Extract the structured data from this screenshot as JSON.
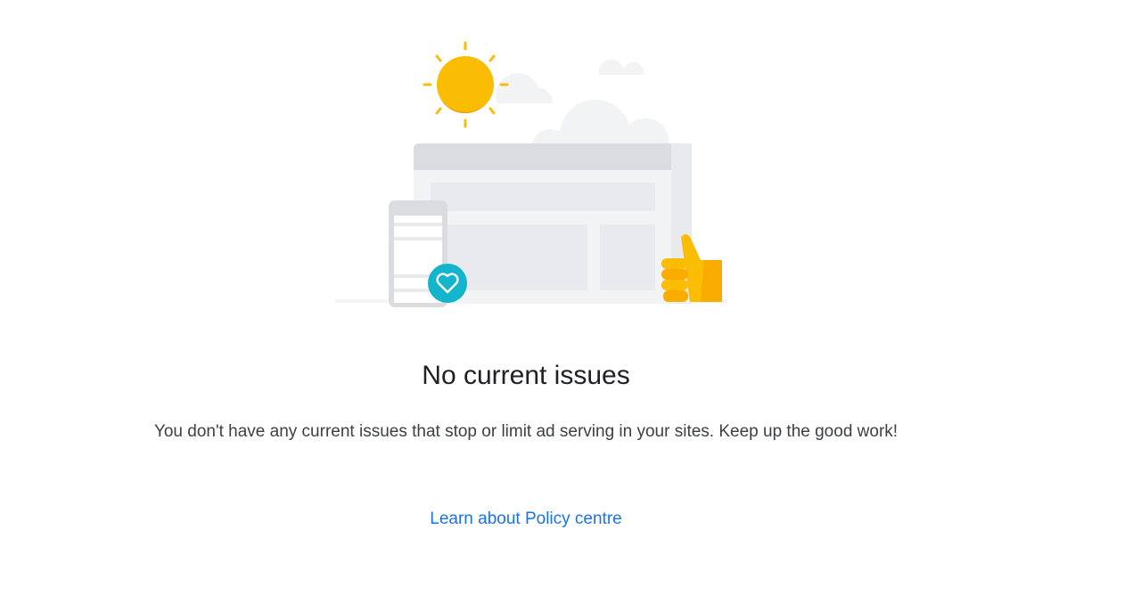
{
  "empty_state": {
    "illustration_icon": "sun-cloud-browser-thumbs-up-illustration",
    "badge_icon": "heart-icon",
    "title": "No current issues",
    "description": "You don't have any current issues that stop or limit ad serving in your sites. Keep up the good work!",
    "link_label": "Learn about Policy centre"
  },
  "colors": {
    "sun": "#fbbc04",
    "sun_shade": "#f29900",
    "thumb": "#fbbc04",
    "thumb_shade": "#f9ab00",
    "badge": "#12b5cb",
    "browser_frame": "#dadce0",
    "browser_body": "#f1f3f4",
    "link": "#1a73e8"
  }
}
